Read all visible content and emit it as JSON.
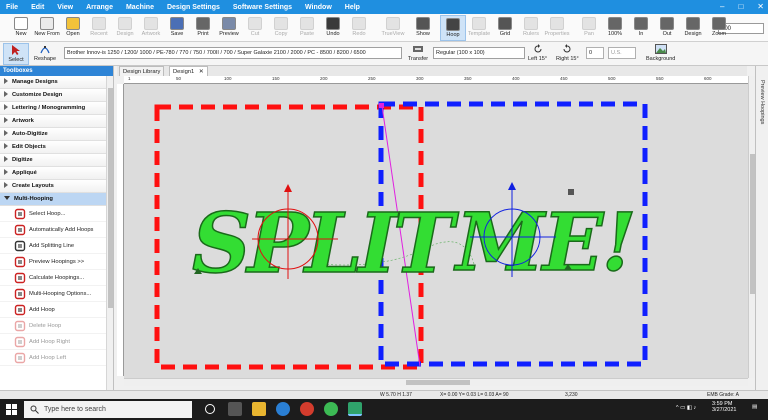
{
  "menu": [
    "File",
    "Edit",
    "View",
    "Arrange",
    "Machine",
    "Design Settings",
    "Software Settings",
    "Window",
    "Help"
  ],
  "window_controls": [
    "–",
    "□",
    "✕"
  ],
  "toolbar": [
    {
      "label": "New",
      "enabled": true,
      "color": "#ffffff"
    },
    {
      "label": "New From",
      "enabled": true,
      "color": "#eaeaea"
    },
    {
      "label": "Open",
      "enabled": true,
      "color": "#f2c23a"
    },
    {
      "label": "Recent",
      "enabled": false,
      "color": "#bbbbbb"
    },
    {
      "label": "Design",
      "enabled": false,
      "color": "#bbbbbb"
    },
    {
      "label": "Artwork",
      "enabled": false,
      "color": "#bbbbbb"
    },
    {
      "label": "Save",
      "enabled": true,
      "color": "#4b6fb5"
    },
    {
      "label": "Print",
      "enabled": true,
      "color": "#666666"
    },
    {
      "label": "Preview",
      "enabled": true,
      "color": "#7a8aa8"
    },
    {
      "label": "Cut",
      "enabled": false,
      "color": "#bbbbbb"
    },
    {
      "label": "Copy",
      "enabled": false,
      "color": "#bbbbbb"
    },
    {
      "label": "Paste",
      "enabled": false,
      "color": "#bbbbbb"
    },
    {
      "label": "Undo",
      "enabled": true,
      "color": "#3a3a3a"
    },
    {
      "label": "Redo",
      "enabled": false,
      "color": "#bbbbbb"
    },
    {
      "label": "TrueView",
      "enabled": false,
      "color": "#bbbbbb"
    },
    {
      "label": "Show",
      "enabled": true,
      "color": "#555555"
    },
    {
      "label": "Hoop",
      "enabled": true,
      "color": "#444444",
      "active": true
    },
    {
      "label": "Template",
      "enabled": false,
      "color": "#bbbbbb"
    },
    {
      "label": "Grid",
      "enabled": true,
      "color": "#555555"
    },
    {
      "label": "Rulers",
      "enabled": false,
      "color": "#bbbbbb"
    },
    {
      "label": "Properties",
      "enabled": false,
      "color": "#bbbbbb"
    },
    {
      "label": "Pan",
      "enabled": false,
      "color": "#bbbbbb"
    },
    {
      "label": "100%",
      "enabled": true,
      "color": "#666666"
    },
    {
      "label": "In",
      "enabled": true,
      "color": "#666666"
    },
    {
      "label": "Out",
      "enabled": true,
      "color": "#666666"
    },
    {
      "label": "Design",
      "enabled": true,
      "color": "#666666"
    },
    {
      "label": "Zoom",
      "enabled": true,
      "color": "#666666"
    }
  ],
  "zoom_value": "100",
  "toolbar2": {
    "select": "Select",
    "reshape": "Reshape",
    "machine": "Brother Innov-is 1250 / 1200/ 1000 / PE-780 / 770 / 750 / 700II / 700 / Super Galaxie 2100 / 2000 / PC - 8500 / 8200 / 6500",
    "transfer": "Transfer",
    "hoop_size": "Regular (100 x 100)",
    "left15": "Left 15°",
    "right15": "Right 15°",
    "rotation_value": "0",
    "units": "U.S.",
    "background": "Background"
  },
  "toolboxes": {
    "title": "Toolboxes",
    "categories": [
      "Manage Designs",
      "Customize Design",
      "Lettering / Monogramming",
      "Artwork",
      "Auto-Digitize",
      "Edit Objects",
      "Digitize",
      "Appliqué",
      "Create Layouts"
    ],
    "open_category": "Multi-Hooping",
    "tools": [
      {
        "label": "Select Hoop...",
        "enabled": true
      },
      {
        "label": "Automatically Add Hoops",
        "enabled": true
      },
      {
        "label": "Add Splitting Line",
        "enabled": true
      },
      {
        "label": "Preview Hoopings >>",
        "enabled": true
      },
      {
        "label": "Calculate Hoopings...",
        "enabled": true
      },
      {
        "label": "Multi-Hooping Options...",
        "enabled": true
      },
      {
        "label": "Add Hoop",
        "enabled": true
      },
      {
        "label": "Delete Hoop",
        "enabled": false
      },
      {
        "label": "Add Hoop Right",
        "enabled": false
      },
      {
        "label": "Add Hoop Left",
        "enabled": false
      }
    ]
  },
  "doc_tabs": [
    "Design Library",
    "Design1"
  ],
  "ruler_top_ticks": [
    "1",
    "50",
    "100",
    "150",
    "200",
    "250",
    "300",
    "350",
    "400",
    "450",
    "500",
    "550",
    "600",
    "650"
  ],
  "design": {
    "text_left": "SPLIT",
    "text_right": "ME!",
    "stitch_color": "#33dd33",
    "hoop_left_color": "#ff1010",
    "hoop_right_color": "#1020ff",
    "split_line_color": "#e020e0"
  },
  "status": {
    "size": "W 5.70 H 1.37",
    "coords": "X= 0.00 Y= 0.03 L= 0.03 A=  90",
    "stitches": "3,230",
    "grade": "EMB Grade: A"
  },
  "taskbar": {
    "search": "Type here to search",
    "time": "3:59 PM",
    "date": "3/27/2021"
  }
}
